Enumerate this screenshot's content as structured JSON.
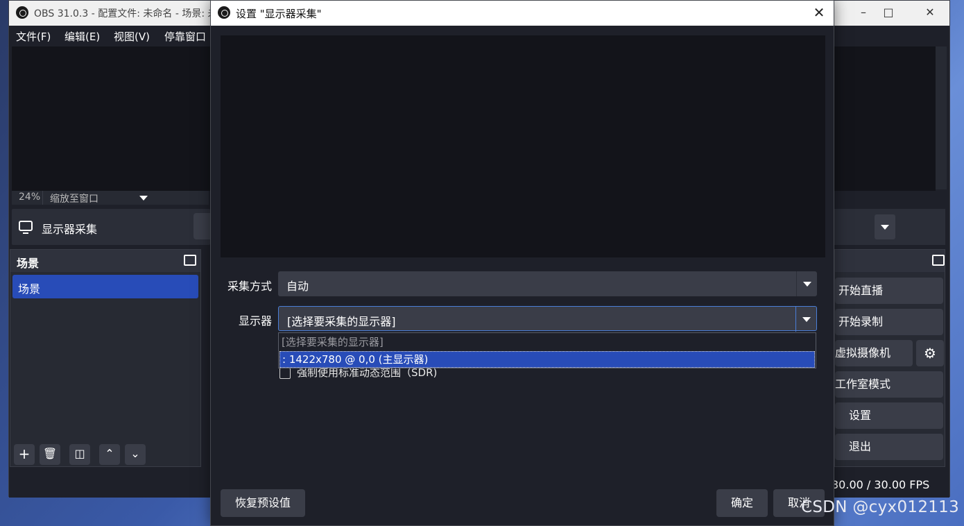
{
  "main_window": {
    "title": "OBS 31.0.3 - 配置文件: 未命名 - 场景: 未",
    "menu": [
      "文件(F)",
      "编辑(E)",
      "视图(V)",
      "停靠窗口"
    ],
    "zoom_percent": "24%",
    "zoom_mode": "缩放至窗口",
    "current_source": "显示器采集",
    "scenes_dock": {
      "title": "场景",
      "items": [
        "场景"
      ]
    },
    "controls": {
      "start_stream": "开始直播",
      "start_record": "开始录制",
      "virtual_camera": "虚拟摄像机",
      "studio_mode": "工作室模式",
      "settings": "设置",
      "exit": "退出"
    },
    "fps": "30.00 / 30.00 FPS"
  },
  "dialog": {
    "title": "设置 \"显示器采集\"",
    "capture_method": {
      "label": "采集方式",
      "value": "自动"
    },
    "display": {
      "label": "显示器",
      "value": "[选择要采集的显示器]",
      "options": [
        "[选择要采集的显示器]",
        ": 1422x780 @ 0,0 (主显示器)"
      ],
      "highlighted_index": 1
    },
    "force_sdr_label": "强制使用标准动态范围（SDR)",
    "buttons": {
      "restore_defaults": "恢复预设值",
      "ok": "确定",
      "cancel": "取消"
    }
  },
  "watermark": "CSDN @cyx012113"
}
